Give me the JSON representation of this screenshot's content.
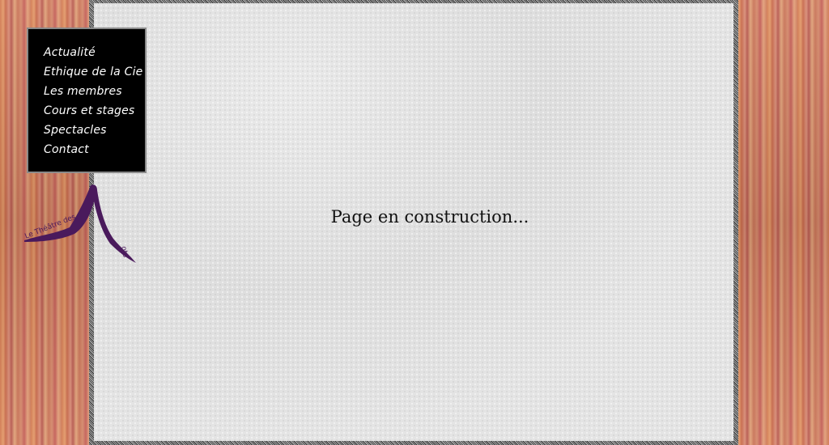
{
  "nav": {
    "items": [
      {
        "label": "Actualité"
      },
      {
        "label": "Ethique de la Cie"
      },
      {
        "label": "Les membres"
      },
      {
        "label": "Cours et stages"
      },
      {
        "label": "Spectacles"
      },
      {
        "label": "Contact"
      }
    ]
  },
  "logo": {
    "text_left": "Le Théâtre des",
    "letter": "M",
    "text_right": "ots",
    "color": "#4a1a5c"
  },
  "main": {
    "message": "Page en construction..."
  },
  "colors": {
    "curtain": "#d27a52",
    "panel": "#e2e2e2",
    "nav_bg": "#000000"
  }
}
